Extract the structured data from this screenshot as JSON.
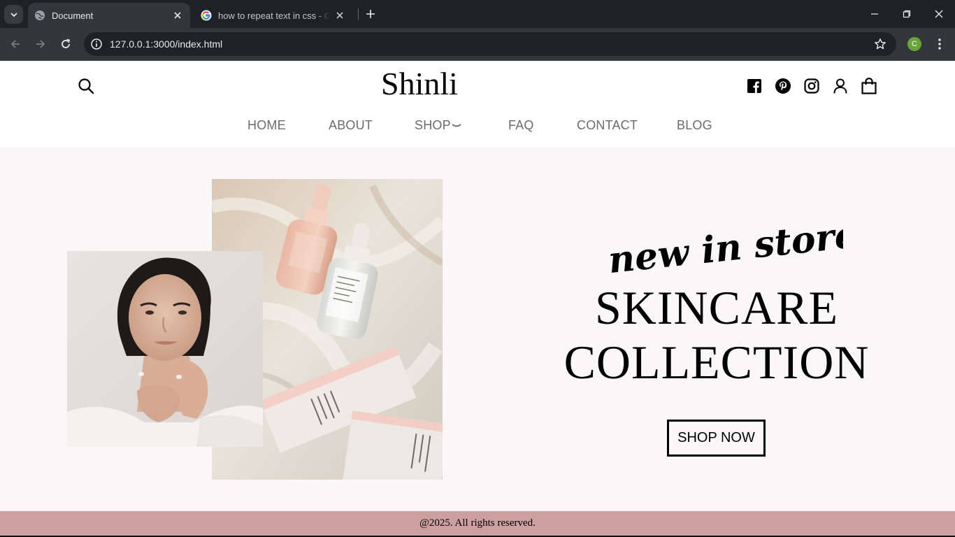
{
  "browser": {
    "tabs": [
      {
        "title": "Document",
        "active": true,
        "favicon": "globe-icon"
      },
      {
        "title": "how to repeat text in css - Google Search",
        "active": false,
        "favicon": "google-icon"
      }
    ],
    "url": "127.0.0.1:3000/index.html",
    "profile_initial": "C",
    "colors": {
      "tabbar": "#202124",
      "toolbar": "#35363a",
      "profile": "#69a43a"
    }
  },
  "site": {
    "brand": "Shinli",
    "nav": [
      {
        "label": "HOME"
      },
      {
        "label": "ABOUT"
      },
      {
        "label": "SHOP",
        "has_dropdown": true
      },
      {
        "label": "FAQ"
      },
      {
        "label": "CONTACT"
      },
      {
        "label": "BLOG"
      }
    ],
    "header_icons": [
      "search-icon",
      "facebook-icon",
      "pinterest-icon",
      "instagram-icon",
      "user-icon",
      "shopping-bag-icon"
    ]
  },
  "hero": {
    "tagline": "new in store",
    "headline_line1": "SKINCARE",
    "headline_line2": "COLLECTION",
    "cta": "SHOP NOW",
    "product_brand_text": "Glossier.",
    "colors": {
      "background": "#f9f7f7"
    }
  },
  "footer": {
    "text": "@2025. All rights reserved.",
    "color": "#cc9fa1"
  }
}
